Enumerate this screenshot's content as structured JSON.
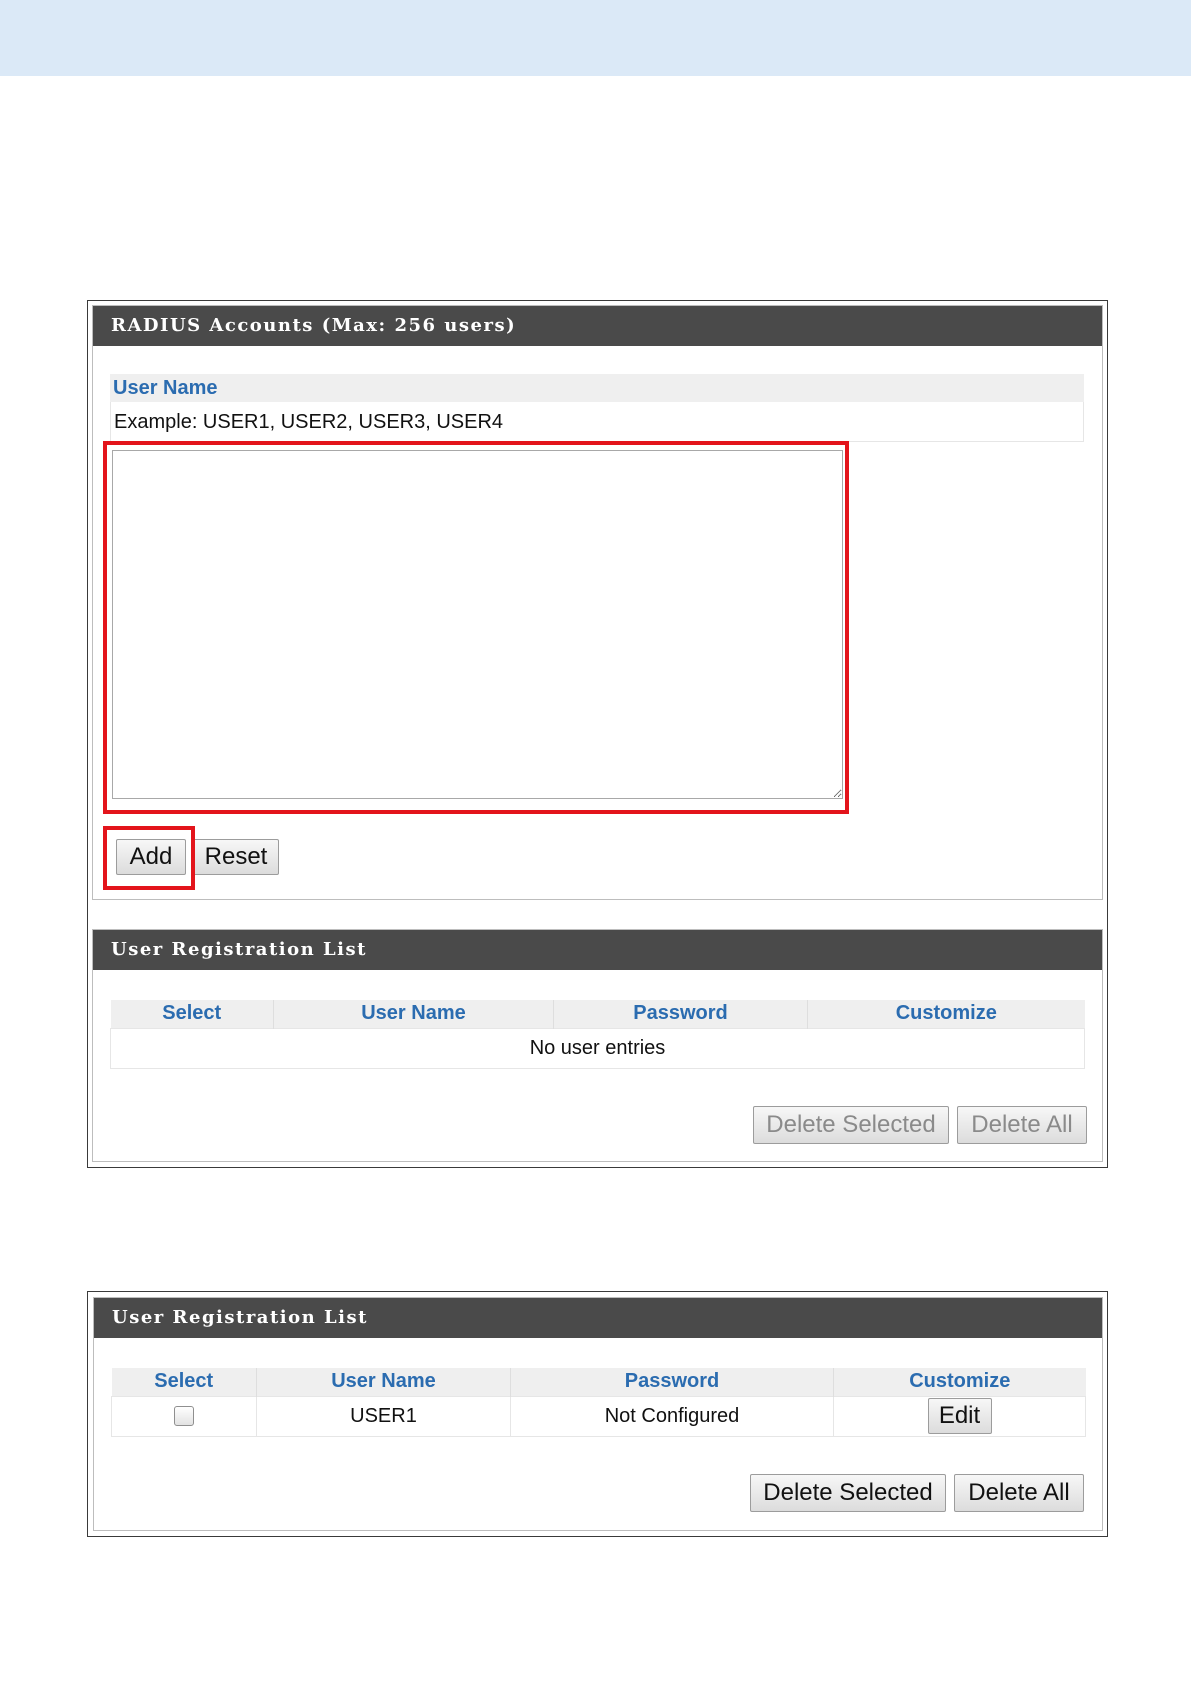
{
  "radius_accounts": {
    "title": "RADIUS Accounts (Max: 256 users)",
    "user_name_label": "User Name",
    "example_text": "Example: USER1, USER2, USER3, USER4",
    "textarea_value": "",
    "add_label": "Add",
    "reset_label": "Reset"
  },
  "list_empty": {
    "title": "User Registration List",
    "columns": [
      "Select",
      "User Name",
      "Password",
      "Customize"
    ],
    "empty_message": "No user entries",
    "delete_selected_label": "Delete Selected",
    "delete_all_label": "Delete All"
  },
  "list_filled": {
    "title": "User Registration List",
    "columns": [
      "Select",
      "User Name",
      "Password",
      "Customize"
    ],
    "rows": [
      {
        "selected": false,
        "user_name": "USER1",
        "password": "Not Configured",
        "customize_label": "Edit"
      }
    ],
    "delete_selected_label": "Delete Selected",
    "delete_all_label": "Delete All"
  },
  "colors": {
    "top_band": "#dbe9f7",
    "header_bg": "#4a4a4a",
    "label_blue": "#2b6cb0",
    "highlight_red": "#e3141b"
  }
}
